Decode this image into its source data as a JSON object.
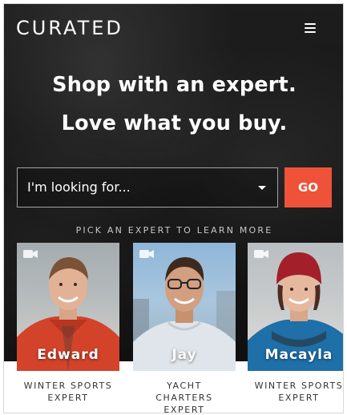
{
  "header": {
    "logo_text": "CURATED",
    "menu_icon": "hamburger-menu-icon"
  },
  "hero": {
    "headline_line1": "Shop with an expert.",
    "headline_line2": "Love what you buy."
  },
  "search": {
    "select_value": "I'm looking for...",
    "go_label": "GO"
  },
  "experts_prompt": "PICK AN EXPERT TO LEARN MORE",
  "experts": [
    {
      "name": "Edward",
      "role_line1": "WINTER SPORTS",
      "role_line2": "EXPERT",
      "role_line3": ""
    },
    {
      "name": "Jay",
      "role_line1": "YACHT",
      "role_line2": "CHARTERS",
      "role_line3": "EXPERT"
    },
    {
      "name": "Macayla",
      "role_line1": "WINTER SPORTS",
      "role_line2": "EXPERT",
      "role_line3": ""
    }
  ],
  "colors": {
    "accent": "#ee5339",
    "hero_bg": "#171717",
    "text_light": "#ffffff"
  }
}
